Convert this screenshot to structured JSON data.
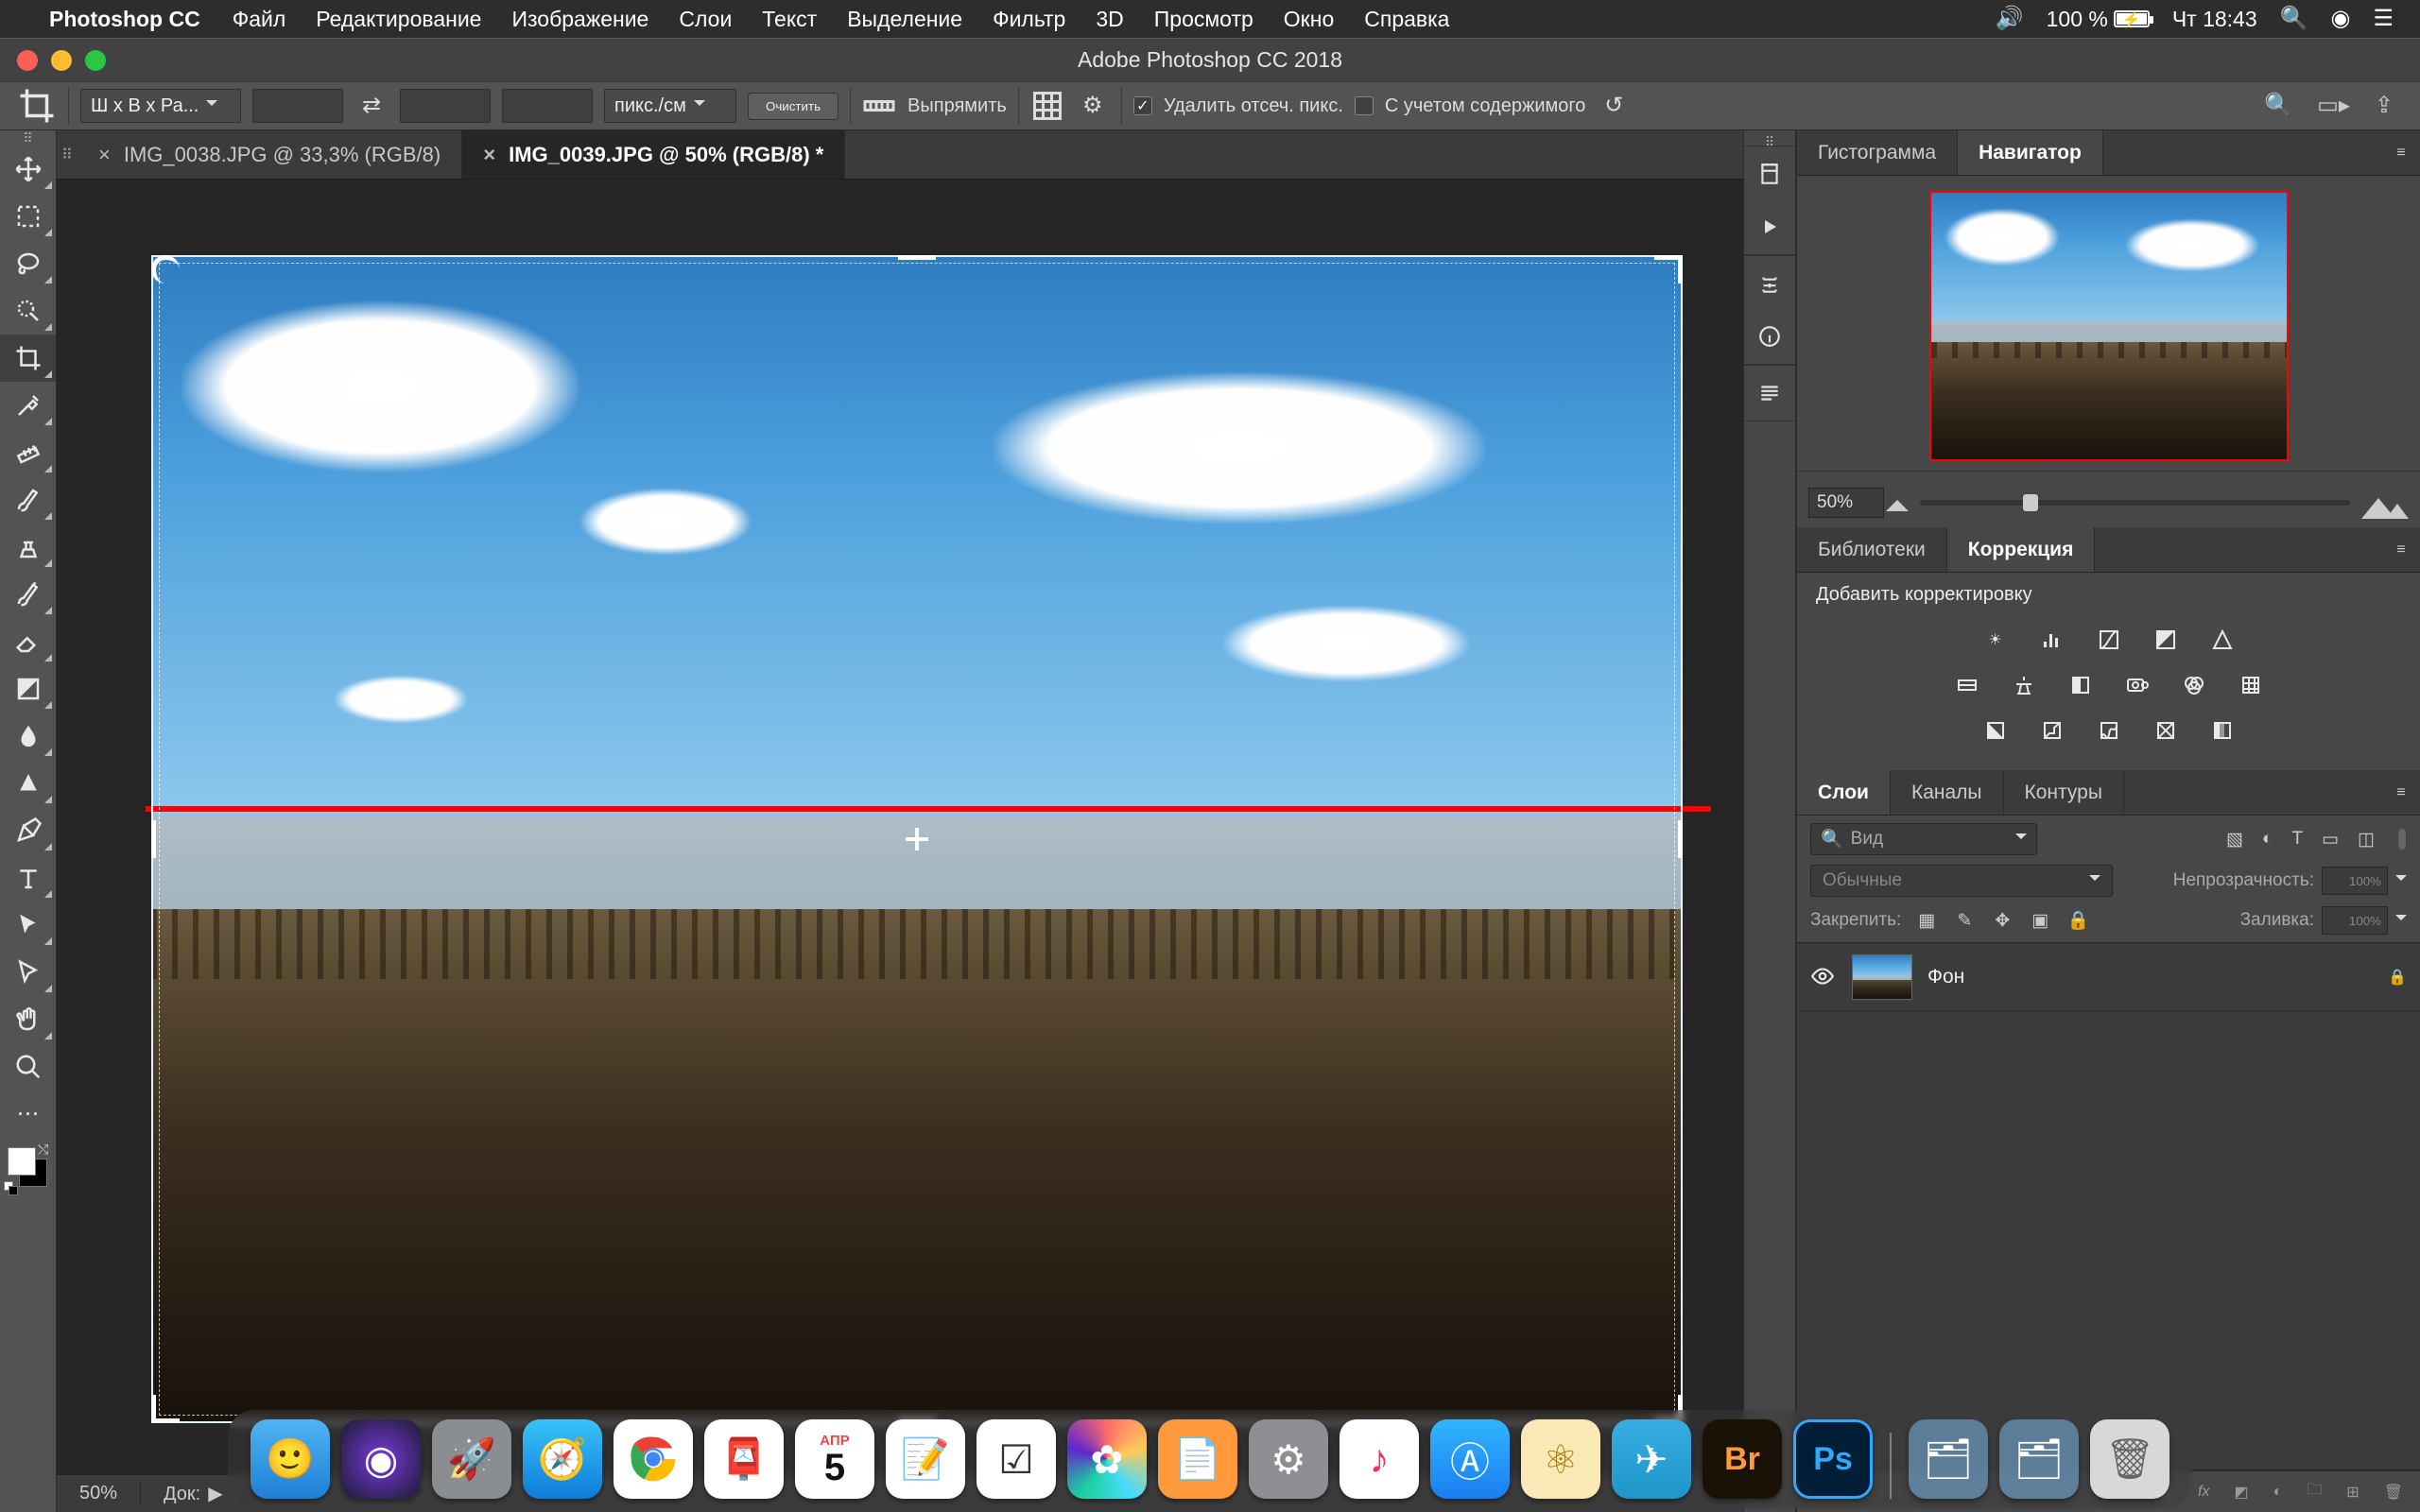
{
  "menubar": {
    "app_name": "Photoshop CC",
    "items": [
      "Файл",
      "Редактирование",
      "Изображение",
      "Слои",
      "Текст",
      "Выделение",
      "Фильтр",
      "3D",
      "Просмотр",
      "Окно",
      "Справка"
    ],
    "battery_pct": "100 %",
    "clock": "Чт 18:43"
  },
  "window": {
    "title": "Adobe Photoshop CC 2018"
  },
  "options_bar": {
    "ratio_preset": "Ш x В x Ра...",
    "units": "пикс./см",
    "clear": "Очистить",
    "straighten": "Выпрямить",
    "delete_cropped": "Удалить отсеч. пикс.",
    "content_aware": "С учетом содержимого"
  },
  "tabs": [
    {
      "label": "IMG_0038.JPG @ 33,3% (RGB/8)",
      "active": false
    },
    {
      "label": "IMG_0039.JPG @ 50% (RGB/8) *",
      "active": true
    }
  ],
  "status": {
    "zoom": "50%",
    "doc_label": "Док:"
  },
  "panels": {
    "nav_tabs": {
      "histogram": "Гистограмма",
      "navigator": "Навигатор"
    },
    "nav_zoom": "50%",
    "lib_tabs": {
      "libraries": "Библиотеки",
      "adjustments": "Коррекция"
    },
    "adjust_heading": "Добавить корректировку",
    "layer_tabs": {
      "layers": "Слои",
      "channels": "Каналы",
      "paths": "Контуры"
    },
    "layer_filter_placeholder": "Вид",
    "blend_mode": "Обычные",
    "opacity_label": "Непрозрачность:",
    "opacity_value": "100%",
    "lock_label": "Закрепить:",
    "fill_label": "Заливка:",
    "fill_value": "100%",
    "layers": [
      {
        "name": "Фон",
        "locked": true
      }
    ]
  },
  "dock": {
    "apps": [
      "finder",
      "siri",
      "launchpad",
      "safari",
      "chrome",
      "mail",
      "calendar",
      "notes",
      "reminders",
      "photos",
      "iwork",
      "preferences",
      "music",
      "appstore",
      "atom",
      "telegram",
      "bridge",
      "photoshop"
    ],
    "calendar_month": "АПР",
    "calendar_day": "5",
    "right": [
      "downloads",
      "applications",
      "trash"
    ]
  }
}
